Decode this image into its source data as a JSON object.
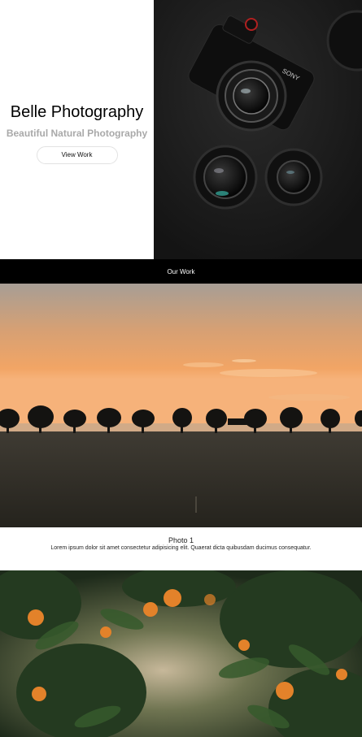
{
  "hero": {
    "title": "Belle Photography",
    "subtitle": "Beautiful Natural Photography",
    "button_label": "View Work",
    "image": "camera-and-lenses-photo"
  },
  "section": {
    "heading": "Our Work"
  },
  "gallery": [
    {
      "image": "sunset-trees-field-photo",
      "title": "Photo 1",
      "description": "Lorem ipsum dolor sit amet consectetur adipisicing elit. Quaerat dicta quibusdam ducimus consequatur."
    },
    {
      "image": "orange-tree-photo"
    }
  ],
  "colors": {
    "section_bar": "#000000",
    "subtitle": "#a9a9a9",
    "hero_image_bg": "#1c1c1c"
  }
}
